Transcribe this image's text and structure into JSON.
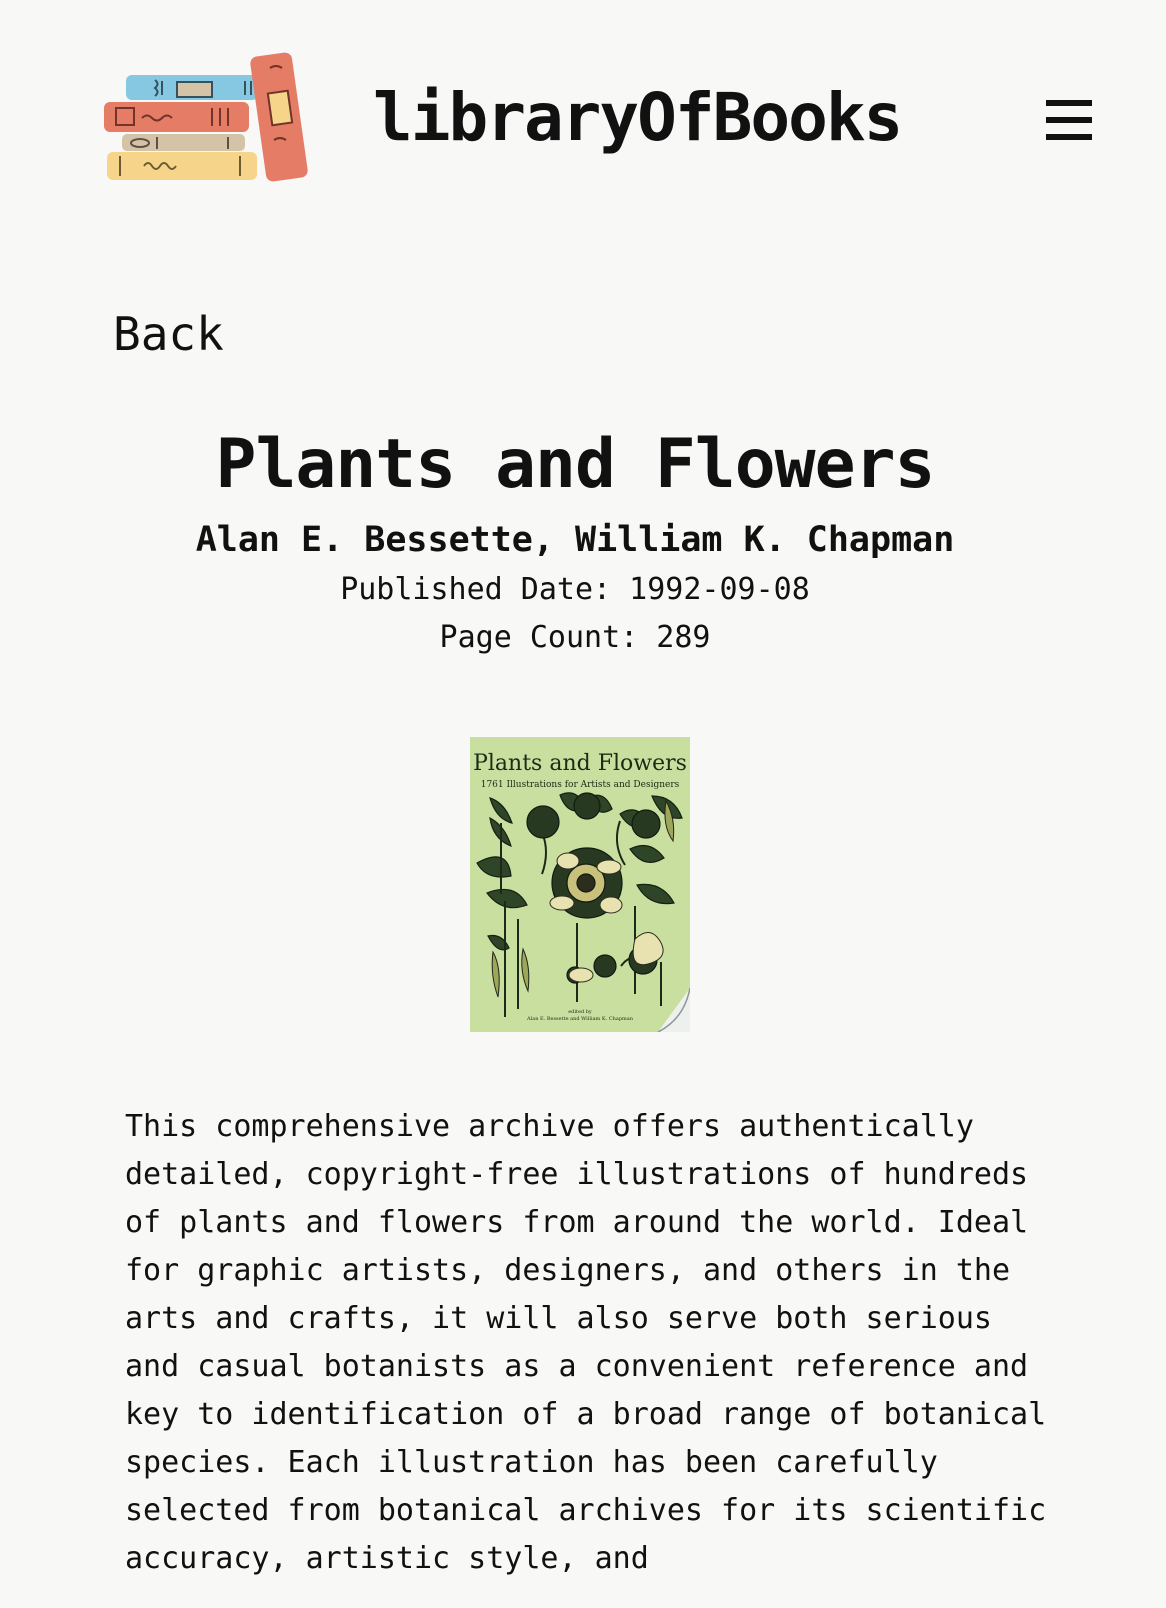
{
  "header": {
    "site_title": "libraryOfBooks",
    "logo_icon": "stacked-books-logo",
    "menu_icon": "hamburger-menu-icon"
  },
  "navigation": {
    "back_label": "Back"
  },
  "book": {
    "title": "Plants and Flowers",
    "authors": "Alan E. Bessette, William K. Chapman",
    "published_date": "Published Date: 1992-09-08",
    "page_count": "Page Count: 289",
    "cover": {
      "title": "Plants and Flowers",
      "subtitle": "1761 Illustrations for Artists and Designers",
      "credit_line": "edited by",
      "editors": "Alan E. Bessette and William K. Chapman"
    },
    "description": "This comprehensive archive offers authentically detailed, copyright-free illustrations of hundreds of plants and flowers from around the world. Ideal for graphic artists, designers, and others in the arts and crafts, it will also serve both serious and casual botanists as a convenient reference and key to identification of a broad range of botanical species. Each illustration has been carefully selected from botanical archives for its scientific accuracy, artistic style, and"
  },
  "colors": {
    "background": "#f8f8f6",
    "text": "#111111",
    "cover_background": "#c8dfa0",
    "logo_blue": "#86c7e1",
    "logo_red": "#e47c66",
    "logo_tan": "#d4c3a7",
    "logo_yellow": "#f6d58a"
  }
}
